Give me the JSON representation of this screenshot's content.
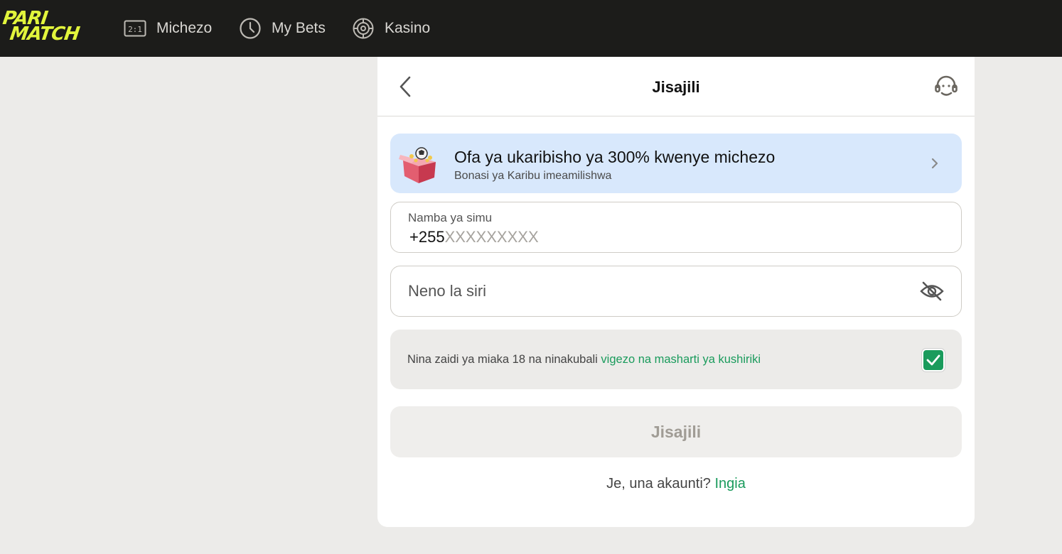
{
  "brand": {
    "logo_line1": "PARI",
    "logo_line2": "MATCH",
    "accent": "#e2f53c"
  },
  "nav": {
    "items": [
      {
        "label": "Michezo",
        "icon": "scoreboard-icon",
        "badge": "2:1"
      },
      {
        "label": "My Bets",
        "icon": "clock-icon"
      },
      {
        "label": "Kasino",
        "icon": "roulette-icon"
      }
    ]
  },
  "form": {
    "title": "Jisajili",
    "promo": {
      "title": "Ofa ya ukaribisho ya 300% kwenye michezo",
      "subtitle": "Bonasi ya Karibu imeamilishwa",
      "icon": "gift-box-icon",
      "background": "#d8e8fc"
    },
    "phone": {
      "label": "Namba ya simu",
      "prefix": "+255",
      "value": "",
      "placeholder": "XXXXXXXXX"
    },
    "password": {
      "placeholder": "Neno la siri",
      "value": ""
    },
    "terms": {
      "text": "Nina zaidi ya miaka 18 na ninakubali ",
      "link_text": "vigezo na masharti ya kushiriki",
      "checked": true,
      "check_color": "#1a9b5c"
    },
    "submit_label": "Jisajili",
    "login_prompt": "Je, una akaunti? ",
    "login_link": "Ingia"
  }
}
